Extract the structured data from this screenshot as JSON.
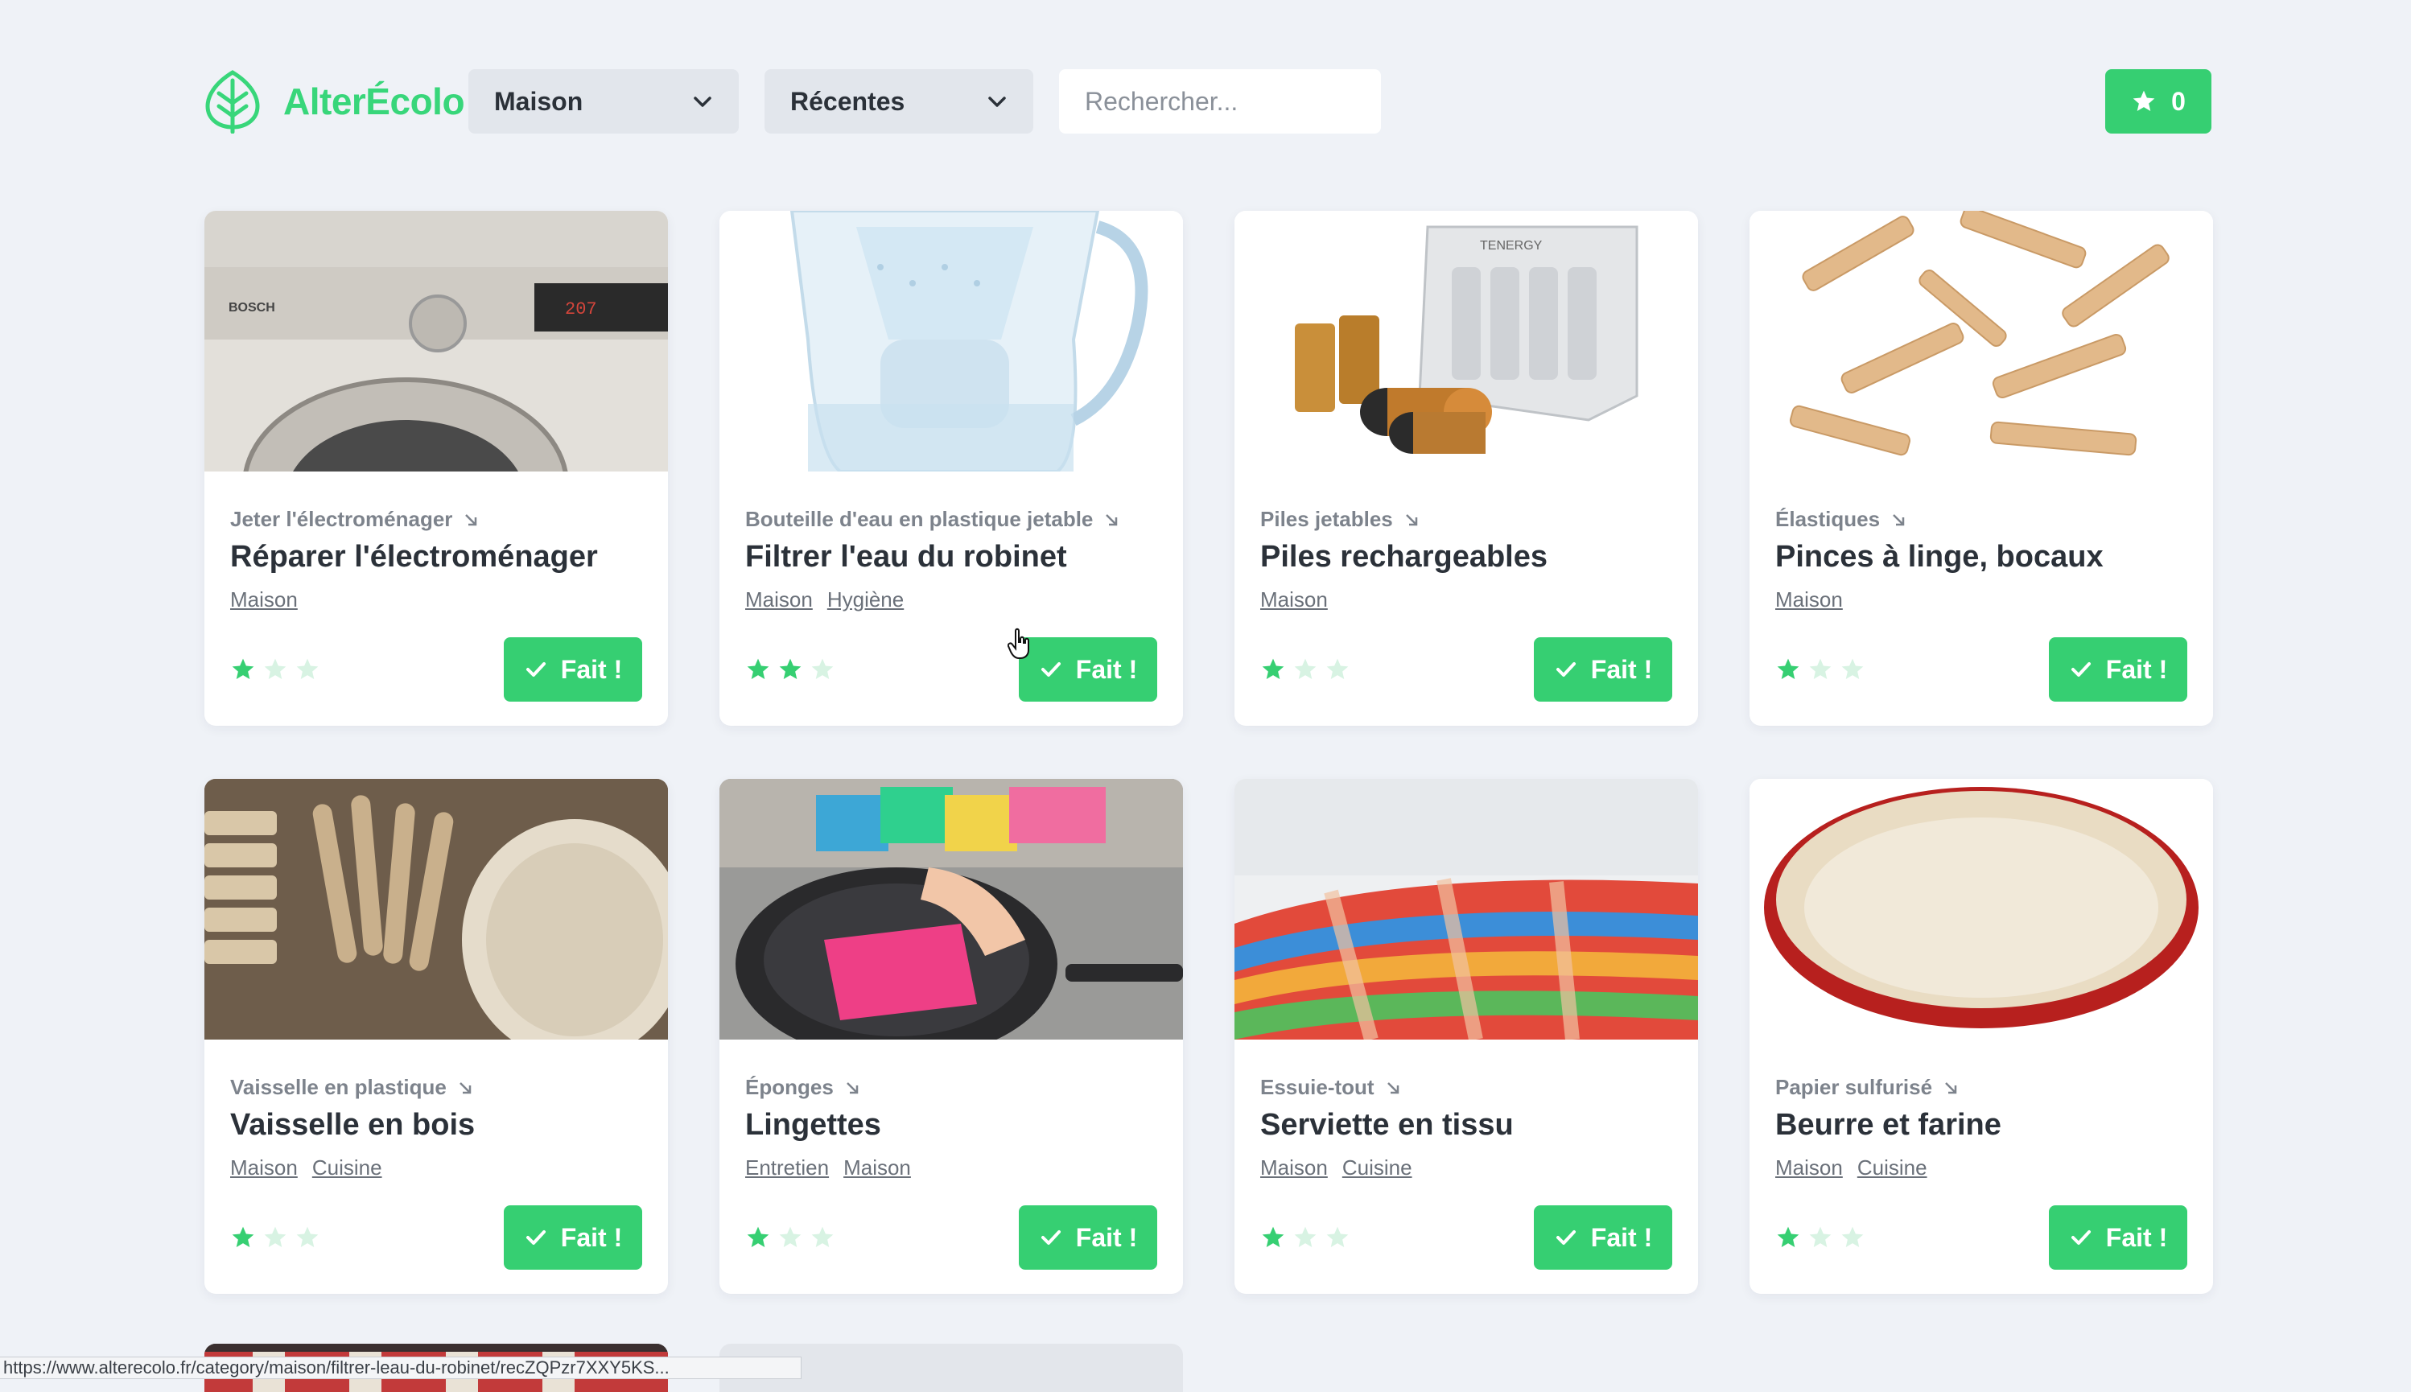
{
  "brand": {
    "name": "AlterÉcolo",
    "accent": "#36cf72"
  },
  "header": {
    "category_select": "Maison",
    "sort_select": "Récentes",
    "search_placeholder": "Rechercher...",
    "favorites_count": "0"
  },
  "cards": [
    {
      "replaces": "Jeter l'électroménager",
      "title": "Réparer l'électroménager",
      "tags": [
        "Maison"
      ],
      "stars": 1,
      "button": "Fait !"
    },
    {
      "replaces": "Bouteille d'eau en plastique jetable",
      "title": "Filtrer l'eau du robinet",
      "tags": [
        "Maison",
        "Hygiène"
      ],
      "stars": 2,
      "button": "Fait !"
    },
    {
      "replaces": "Piles jetables",
      "title": "Piles rechargeables",
      "tags": [
        "Maison"
      ],
      "stars": 1,
      "button": "Fait !"
    },
    {
      "replaces": "Élastiques",
      "title": "Pinces à linge, bocaux",
      "tags": [
        "Maison"
      ],
      "stars": 1,
      "button": "Fait !"
    },
    {
      "replaces": "Vaisselle en plastique",
      "title": "Vaisselle en bois",
      "tags": [
        "Maison",
        "Cuisine"
      ],
      "stars": 1,
      "button": "Fait !"
    },
    {
      "replaces": "Éponges",
      "title": "Lingettes",
      "tags": [
        "Entretien",
        "Maison"
      ],
      "stars": 1,
      "button": "Fait !"
    },
    {
      "replaces": "Essuie-tout",
      "title": "Serviette en tissu",
      "tags": [
        "Maison",
        "Cuisine"
      ],
      "stars": 1,
      "button": "Fait !"
    },
    {
      "replaces": "Papier sulfurisé",
      "title": "Beurre et farine",
      "tags": [
        "Maison",
        "Cuisine"
      ],
      "stars": 1,
      "button": "Fait !"
    }
  ],
  "status_bar_url": "https://www.alterecolo.fr/category/maison/filtrer-leau-du-robinet/recZQPzr7XXY5KS..."
}
